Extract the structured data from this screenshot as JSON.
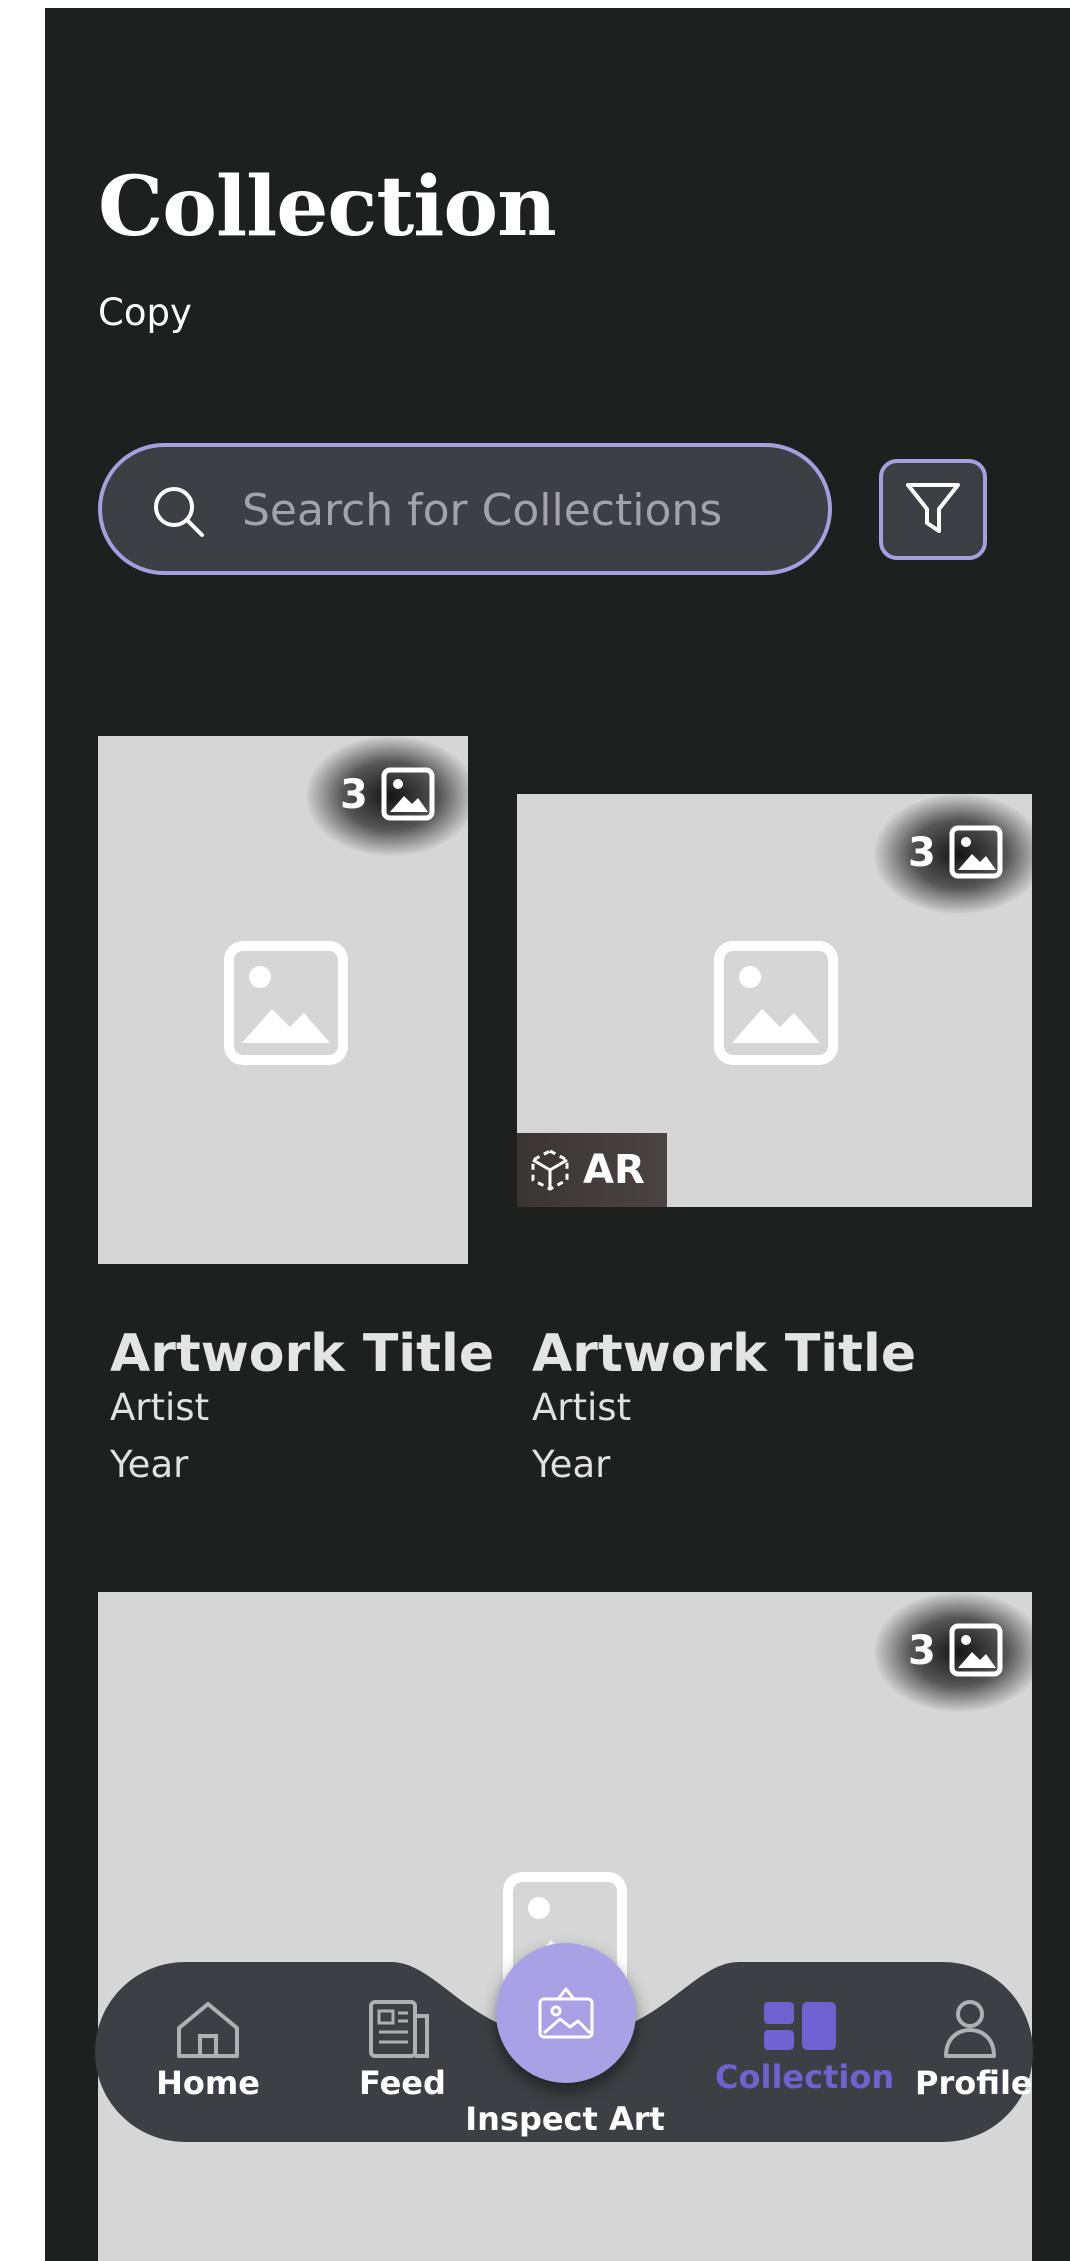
{
  "header": {
    "title": "Collection",
    "subtitle": "Copy"
  },
  "search": {
    "placeholder": "Search for Collections"
  },
  "cards": [
    {
      "title": "Artwork Title",
      "artist": "Artist",
      "year": "Year",
      "image_count": "3",
      "ar_label": ""
    },
    {
      "title": "Artwork Title",
      "artist": "Artist",
      "year": "Year",
      "image_count": "3",
      "ar_label": "AR"
    },
    {
      "image_count": "3"
    }
  ],
  "nav": {
    "items": [
      {
        "label": "Home",
        "icon": "home-icon",
        "active": false
      },
      {
        "label": "Feed",
        "icon": "newspaper-icon",
        "active": false
      },
      {
        "label": "Inspect Art",
        "icon": "inspect-art-icon",
        "active": false
      },
      {
        "label": "Collection",
        "icon": "collection-icon",
        "active": true
      },
      {
        "label": "Profile",
        "icon": "person-icon",
        "active": false
      }
    ]
  },
  "colors": {
    "background": "#1e1f1f",
    "accent": "#a79ee0",
    "accent_active": "#7060d0",
    "surface": "#3e3f44",
    "placeholder_image": "#d6d6d6"
  }
}
